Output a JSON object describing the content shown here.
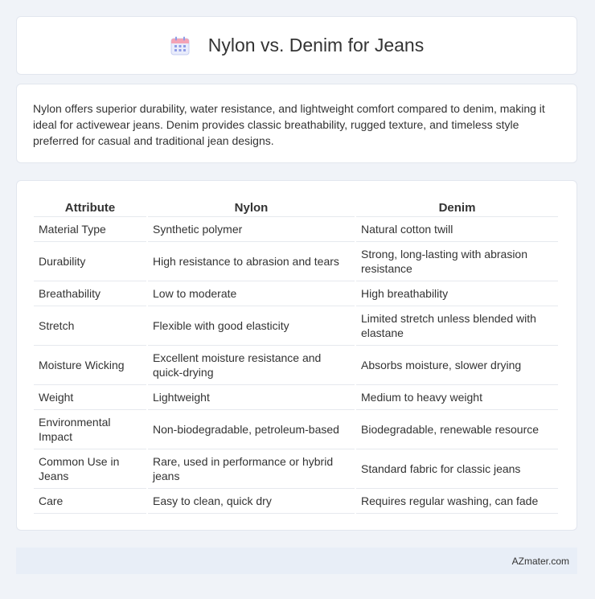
{
  "header": {
    "icon": "calendar-icon",
    "title": "Nylon vs. Denim for Jeans"
  },
  "summary": {
    "text": "Nylon offers superior durability, water resistance, and lightweight comfort compared to denim, making it ideal for activewear jeans. Denim provides classic breathability, rugged texture, and timeless style preferred for casual and traditional jean designs."
  },
  "table": {
    "headers": [
      "Attribute",
      "Nylon",
      "Denim"
    ],
    "rows": [
      [
        "Material Type",
        "Synthetic polymer",
        "Natural cotton twill"
      ],
      [
        "Durability",
        "High resistance to abrasion and tears",
        "Strong, long-lasting with abrasion resistance"
      ],
      [
        "Breathability",
        "Low to moderate",
        "High breathability"
      ],
      [
        "Stretch",
        "Flexible with good elasticity",
        "Limited stretch unless blended with elastane"
      ],
      [
        "Moisture Wicking",
        "Excellent moisture resistance and quick-drying",
        "Absorbs moisture, slower drying"
      ],
      [
        "Weight",
        "Lightweight",
        "Medium to heavy weight"
      ],
      [
        "Environmental Impact",
        "Non-biodegradable, petroleum-based",
        "Biodegradable, renewable resource"
      ],
      [
        "Common Use in Jeans",
        "Rare, used in performance or hybrid jeans",
        "Standard fabric for classic jeans"
      ],
      [
        "Care",
        "Easy to clean, quick dry",
        "Requires regular washing, can fade"
      ]
    ]
  },
  "footer": {
    "brand": "AZmater.com"
  },
  "colors": {
    "page_background": "#f0f3f8",
    "card_background": "#ffffff",
    "footer_background": "#e8eef7",
    "icon_accent": "#7b8de0"
  }
}
